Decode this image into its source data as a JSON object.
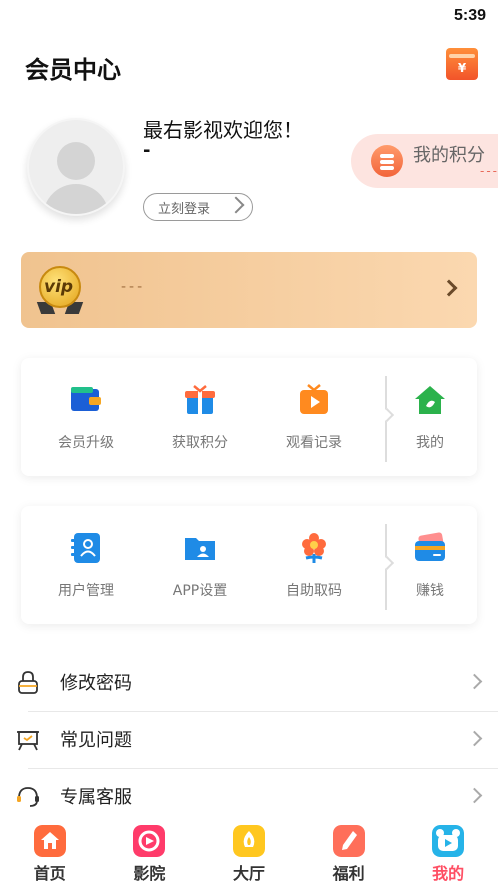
{
  "status_bar": {
    "time": "5:39"
  },
  "header": {
    "title": "会员中心",
    "wallet_icon": "wallet-icon",
    "wallet_symbol": "¥"
  },
  "profile": {
    "welcome": "最右影视欢迎您！",
    "username": "-",
    "login_label": "立刻登录"
  },
  "points": {
    "label": "我的积分",
    "value": "---"
  },
  "vip": {
    "badge": "vip",
    "text": "---"
  },
  "grid_one": [
    {
      "label": "会员升级",
      "icon": "wallet-icon"
    },
    {
      "label": "获取积分",
      "icon": "gift-icon"
    },
    {
      "label": "观看记录",
      "icon": "tv-play-icon"
    },
    {
      "label": "我的",
      "icon": "home-icon"
    }
  ],
  "grid_two": [
    {
      "label": "用户管理",
      "icon": "contacts-icon"
    },
    {
      "label": "APP设置",
      "icon": "user-folder-icon"
    },
    {
      "label": "自助取码",
      "icon": "flower-icon"
    },
    {
      "label": "赚钱",
      "icon": "card-icon"
    }
  ],
  "menu": [
    {
      "label": "修改密码",
      "icon": "lock-icon"
    },
    {
      "label": "常见问题",
      "icon": "board-icon"
    },
    {
      "label": "专属客服",
      "icon": "headset-icon"
    }
  ],
  "tabbar": [
    {
      "label": "首页",
      "icon": "home-tab-icon",
      "color": "#ff6b3d"
    },
    {
      "label": "影院",
      "icon": "cinema-tab-icon",
      "color": "#ff3b6a"
    },
    {
      "label": "大厅",
      "icon": "hall-tab-icon",
      "color": "#ffc71f"
    },
    {
      "label": "福利",
      "icon": "welfare-tab-icon",
      "color": "#ff6f5a"
    },
    {
      "label": "我的",
      "icon": "mine-tab-icon",
      "color": "#26b3e8"
    }
  ],
  "colors": {
    "accent": "#ff4f64",
    "vip_gold": "#f0c38f",
    "points_bg": "#fde4e0"
  }
}
